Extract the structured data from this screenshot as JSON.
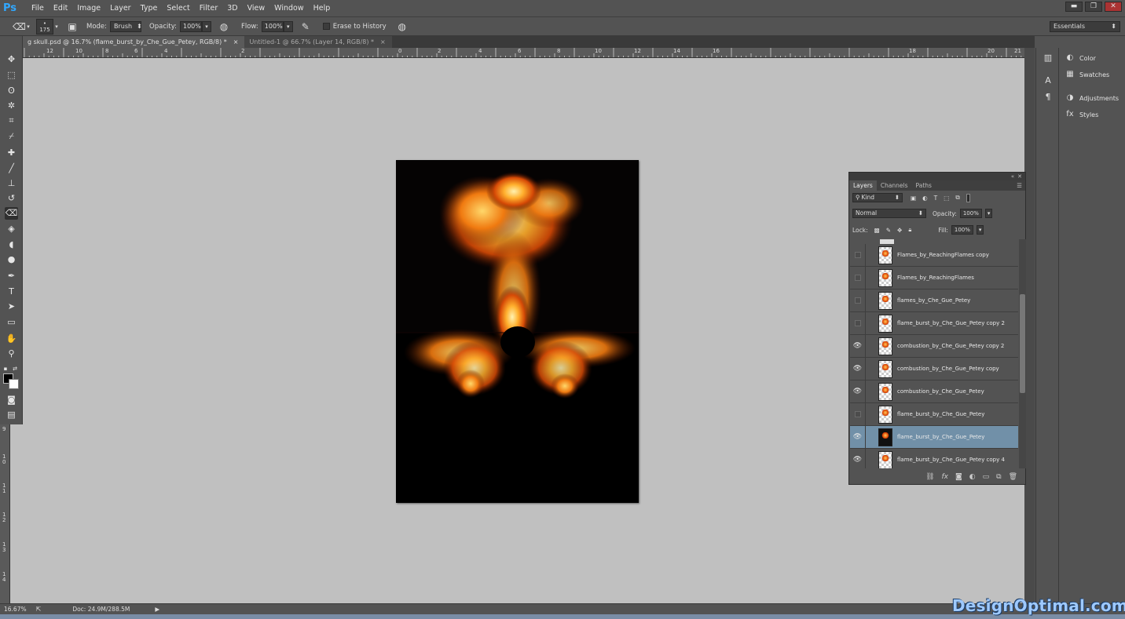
{
  "app": {
    "logo": "Ps"
  },
  "menu": [
    "File",
    "Edit",
    "Image",
    "Layer",
    "Type",
    "Select",
    "Filter",
    "3D",
    "View",
    "Window",
    "Help"
  ],
  "window_controls": {
    "minimize": "▬",
    "restore": "❐",
    "close": "✕"
  },
  "options": {
    "brush_size": "175",
    "mode_label": "Mode:",
    "mode_value": "Brush",
    "opacity_label": "Opacity:",
    "opacity_value": "100%",
    "flow_label": "Flow:",
    "flow_value": "100%",
    "erase_history_label": "Erase to History",
    "workspace": "Essentials"
  },
  "tabs": [
    {
      "label": "g skull.psd @ 16.7% (flame_burst_by_Che_Gue_Petey, RGB/8) *",
      "close": "×"
    },
    {
      "label": "Untitled-1 @ 66.7% (Layer 14, RGB/8) *",
      "close": "×"
    }
  ],
  "ruler_top": [
    "12",
    "10",
    "8",
    "6",
    "4",
    "2",
    "0",
    "2",
    "4",
    "6",
    "8",
    "10",
    "12",
    "14",
    "16",
    "18",
    "20",
    "21"
  ],
  "ruler_left": [
    "9",
    "1 0",
    "1 1",
    "1 2",
    "1 3",
    "1 4"
  ],
  "status": {
    "zoom": "16.67%",
    "doc": "Doc: 24.9M/288.5M"
  },
  "dock": {
    "items": [
      "Color",
      "Swatches",
      "Adjustments",
      "Styles"
    ]
  },
  "layers_panel": {
    "tabs": [
      "Layers",
      "Channels",
      "Paths"
    ],
    "filter_kind": "Kind",
    "blend_mode": "Normal",
    "opacity_label": "Opacity:",
    "opacity_value": "100%",
    "lock_label": "Lock:",
    "fill_label": "Fill:",
    "fill_value": "100%",
    "layers": [
      {
        "name": "Flames_by_ReachingFlames copy",
        "visible": false,
        "selected": false
      },
      {
        "name": "Flames_by_ReachingFlames",
        "visible": false,
        "selected": false
      },
      {
        "name": "flames_by_Che_Gue_Petey",
        "visible": false,
        "selected": false
      },
      {
        "name": "flame_burst_by_Che_Gue_Petey copy 2",
        "visible": false,
        "selected": false
      },
      {
        "name": "combustion_by_Che_Gue_Petey copy 2",
        "visible": true,
        "selected": false
      },
      {
        "name": "combustion_by_Che_Gue_Petey copy",
        "visible": true,
        "selected": false
      },
      {
        "name": "combustion_by_Che_Gue_Petey",
        "visible": true,
        "selected": false
      },
      {
        "name": "flame_burst_by_Che_Gue_Petey",
        "visible": false,
        "selected": false
      },
      {
        "name": "flame_burst_by_Che_Gue_Petey",
        "visible": true,
        "selected": true
      },
      {
        "name": "flame_burst_by_Che_Gue_Petey copy 4",
        "visible": true,
        "selected": false
      }
    ]
  },
  "watermark": "DesignOptimal.com"
}
